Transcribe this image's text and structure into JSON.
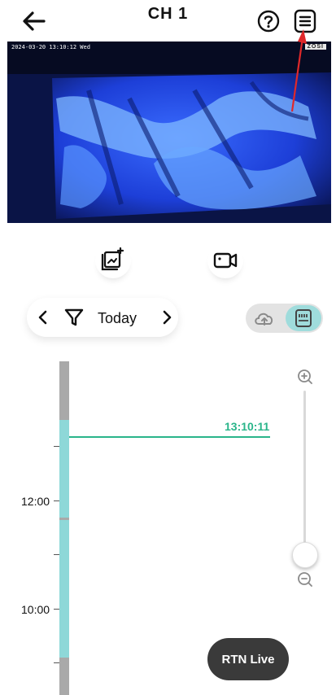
{
  "header": {
    "title": "CH 1",
    "back_icon": "arrow-left-icon",
    "help_icon": "question-circle-icon",
    "menu_icon": "list-menu-icon"
  },
  "video": {
    "osd_datetime": "2024-03-20 13:10:12   Wed",
    "osd_brand": "ZOSI"
  },
  "actions": {
    "snapshot_icon": "snapshot-icon",
    "record_icon": "video-record-icon"
  },
  "date_nav": {
    "label": "Today",
    "prev_icon": "chevron-left-icon",
    "next_icon": "chevron-right-icon",
    "filter_icon": "filter-icon"
  },
  "source_toggle": {
    "options": [
      "cloud",
      "sd-card"
    ],
    "selected": "sd-card"
  },
  "timeline": {
    "current_time": "13:10:11",
    "labels": [
      "12:00",
      "10:00"
    ]
  },
  "zoom": {
    "in_icon": "zoom-in-icon",
    "out_icon": "zoom-out-icon",
    "level": 0.06
  },
  "live_button": {
    "label": "RTN Live"
  },
  "colors": {
    "accent_green": "#2ab58a",
    "recording_teal": "#8ed8d8",
    "annotation_red": "#e0282a"
  }
}
